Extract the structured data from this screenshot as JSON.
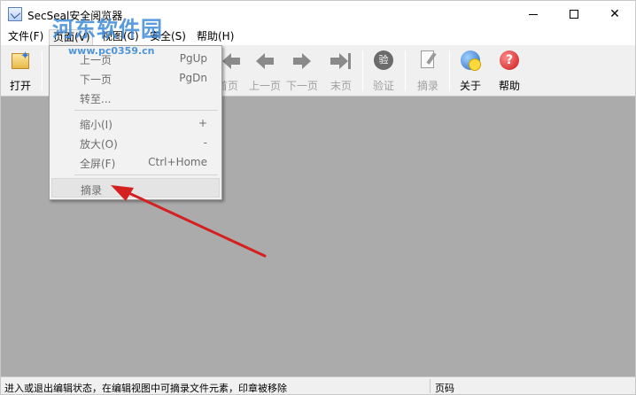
{
  "window": {
    "title": "SecSeal安全阅览器",
    "watermark": "河东软件园",
    "watermark_url": "www.pc0359.cn"
  },
  "menubar": {
    "items": [
      {
        "label": "文件(F)"
      },
      {
        "label": "页面(V)"
      },
      {
        "label": "视图(C)"
      },
      {
        "label": "安全(S)"
      },
      {
        "label": "帮助(H)"
      }
    ]
  },
  "toolbar": {
    "open": "打开",
    "first": "首页",
    "prev": "上一页",
    "next": "下一页",
    "last": "末页",
    "verify": "验证",
    "verify_glyph": "验",
    "excerpt": "摘录",
    "about": "关于",
    "help": "帮助",
    "help_glyph": "?"
  },
  "dropdown": {
    "items": [
      {
        "label": "上一页",
        "shortcut": "PgUp"
      },
      {
        "label": "下一页",
        "shortcut": "PgDn"
      },
      {
        "label": "转至...",
        "shortcut": ""
      },
      {
        "label": "缩小(I)",
        "shortcut": "+"
      },
      {
        "label": "放大(O)",
        "shortcut": "-"
      },
      {
        "label": "全屏(F)",
        "shortcut": "Ctrl+Home"
      },
      {
        "label": "摘录",
        "shortcut": ""
      }
    ]
  },
  "statusbar": {
    "message": "进入或退出编辑状态，在编辑视图中可摘录文件元素，印章被移除",
    "page_label": "页码"
  },
  "colors": {
    "workspace": "#ababab",
    "annotation_arrow": "#d42020",
    "watermark": "#3d8ad6"
  }
}
